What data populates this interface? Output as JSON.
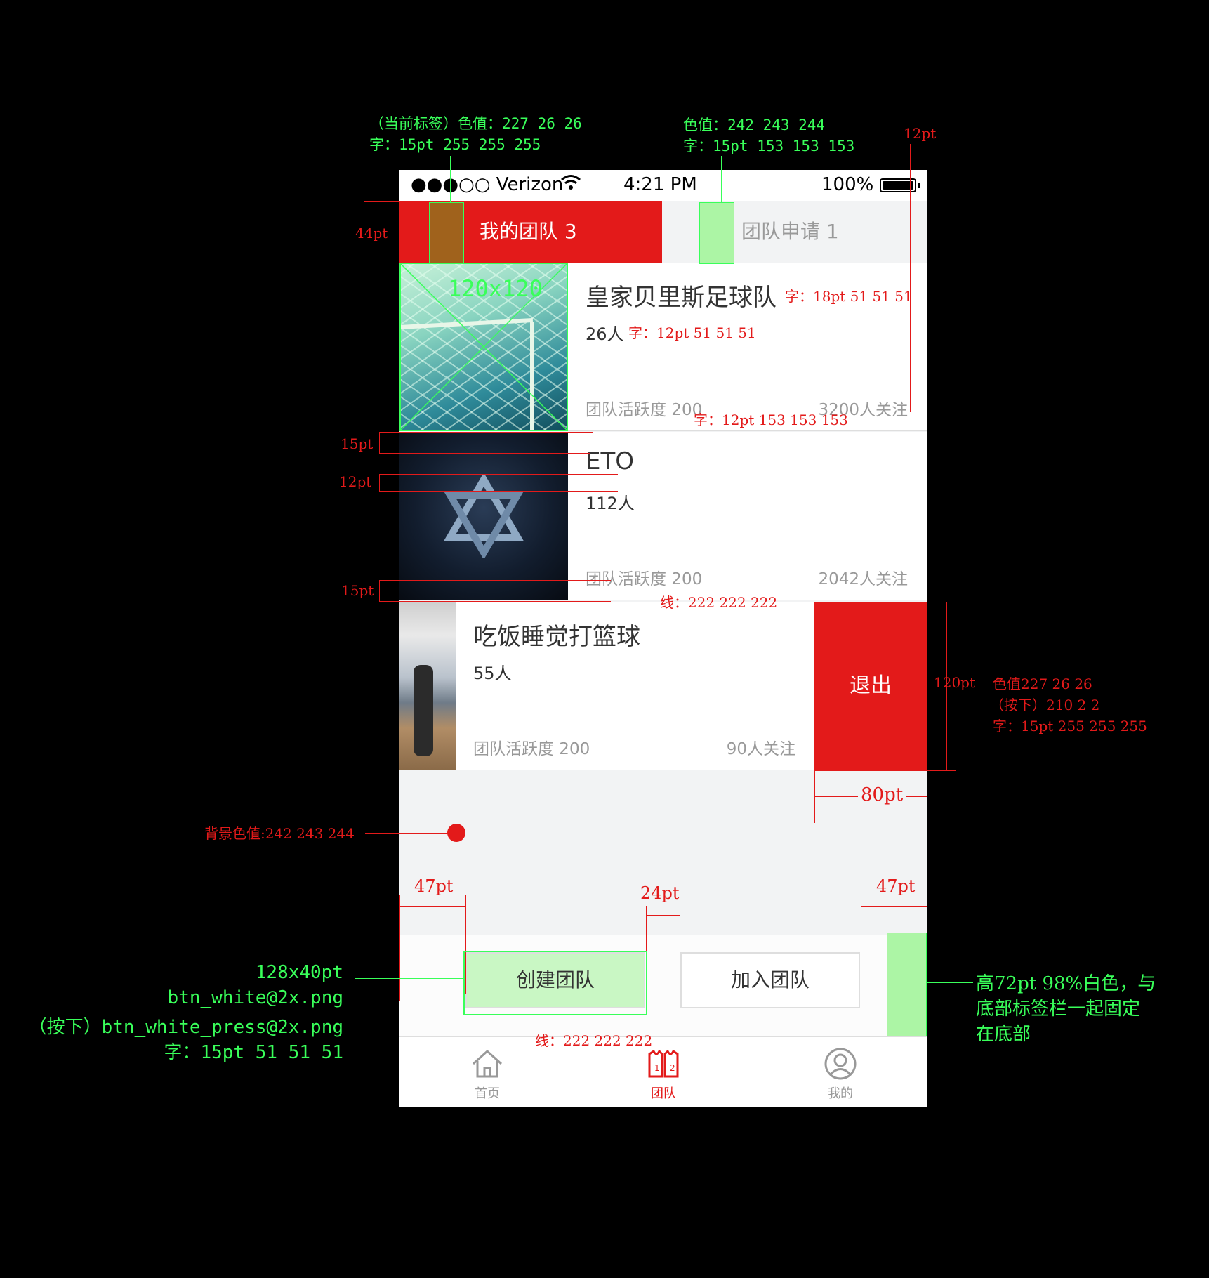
{
  "status_bar": {
    "carrier": "●●●○○ Verizon",
    "time": "4:21 PM",
    "battery": "100%"
  },
  "tabs": {
    "active": "我的团队 3",
    "inactive": "团队申请 1"
  },
  "teams": [
    {
      "name": "皇家贝里斯足球队",
      "members": "26人",
      "activity": "团队活跃度 200",
      "followers": "3200人关注"
    },
    {
      "name": "ETO",
      "members": "112人",
      "activity": "团队活跃度 200",
      "followers": "2042人关注"
    },
    {
      "name": "吃饭睡觉打篮球",
      "members": "55人",
      "activity": "团队活跃度 200",
      "followers": "90人关注"
    }
  ],
  "quit_label": "退出",
  "buttons": {
    "create": "创建团队",
    "join": "加入团队"
  },
  "tabbar": {
    "home": "首页",
    "team": "团队",
    "mine": "我的"
  },
  "annotations": {
    "active_tab_color": "（当前标签）色值：227 26 26",
    "active_tab_font": "字：15pt 255 255 255",
    "inactive_tab_color": "色值：242 243 244",
    "inactive_tab_font": "字：15pt 153 153 153",
    "right_margin": "12pt",
    "tab_height": "44pt",
    "thumb_size": "120x120",
    "name_font": "字：18pt 51 51 51",
    "count_font": "字：12pt 51 51 51",
    "meta_font": "字：12pt 153 153 153",
    "gap1": "15pt",
    "gap2": "12pt",
    "gap3": "15pt",
    "line_color": "线：222 222 222",
    "row_height": "120pt",
    "quit_color": "色值227 26 26",
    "quit_pressed": "（按下）210 2 2",
    "quit_font": "字：15pt 255 255 255",
    "quit_width": "80pt",
    "bg_color": "背景色值:242 243 244",
    "btn_margin_left": "47pt",
    "btn_gap": "24pt",
    "btn_margin_right": "47pt",
    "btn_size": "128x40pt",
    "btn_image": "btn_white@2x.png",
    "btn_image_pressed": "（按下）btn_white_press@2x.png",
    "btn_font": "字：15pt 51 51 51",
    "bottom_line": "线：222 222 222",
    "bottom_note_1": "高72pt 98%白色，与",
    "bottom_note_2": "底部标签栏一起固定",
    "bottom_note_3": "在底部"
  },
  "colors": {
    "accent": "#e31a1a",
    "background": "#f2f3f4",
    "line": "#dedede",
    "annotation_green": "#39ff5a"
  }
}
